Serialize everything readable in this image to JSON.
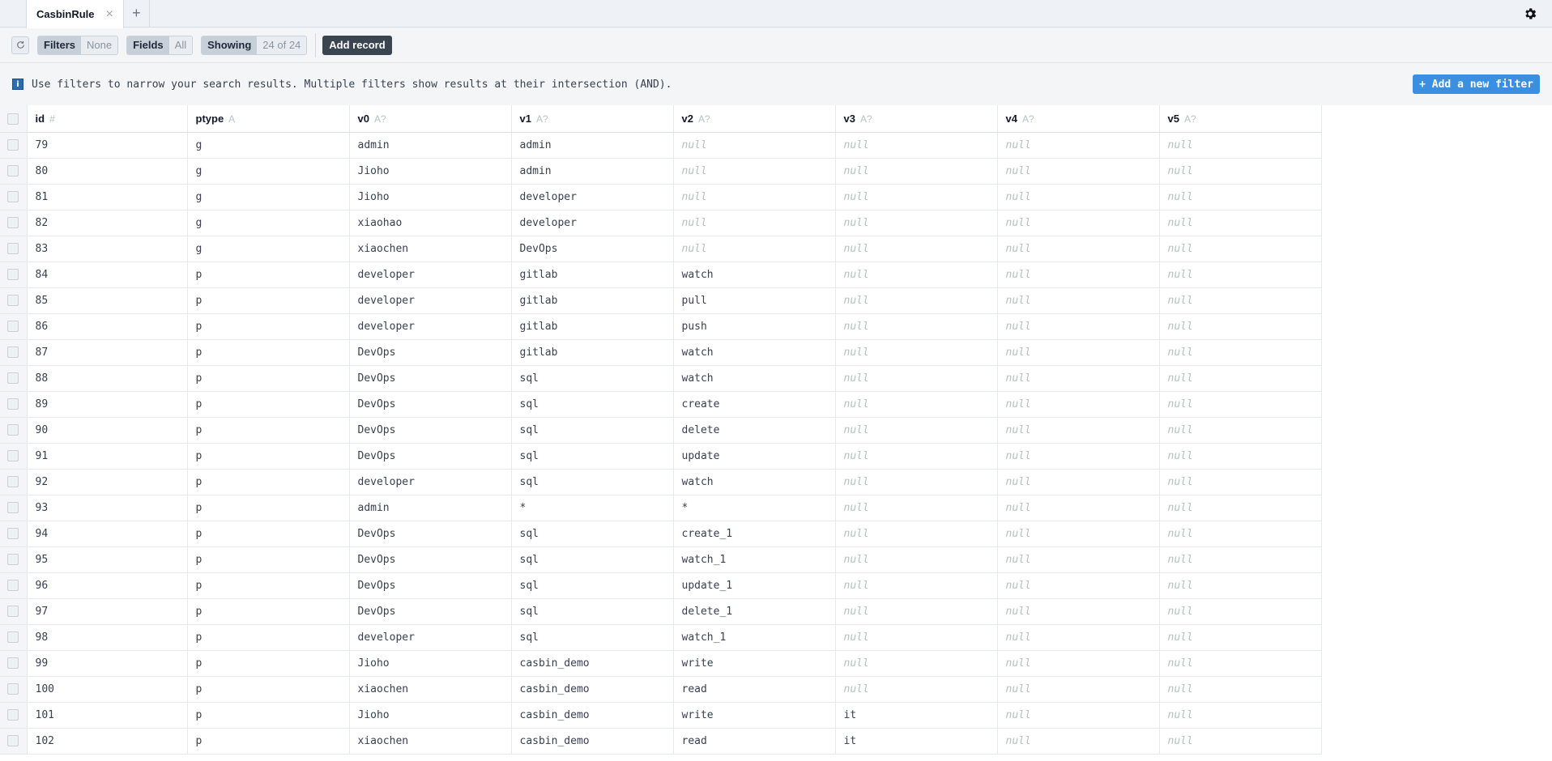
{
  "tab": {
    "label": "CasbinRule",
    "close_glyph": "×",
    "new_glyph": "+"
  },
  "toolbar": {
    "filters_label": "Filters",
    "filters_value": "None",
    "fields_label": "Fields",
    "fields_value": "All",
    "showing_label": "Showing",
    "showing_value": "24 of 24",
    "add_record": "Add record"
  },
  "info": {
    "icon": "i",
    "text": "Use filters to narrow your search results. Multiple filters show results at their intersection (AND).",
    "add_filter": "+ Add a new filter"
  },
  "columns": [
    {
      "name": "id",
      "hint": "#"
    },
    {
      "name": "ptype",
      "hint": "A"
    },
    {
      "name": "v0",
      "hint": "A?"
    },
    {
      "name": "v1",
      "hint": "A?"
    },
    {
      "name": "v2",
      "hint": "A?"
    },
    {
      "name": "v3",
      "hint": "A?"
    },
    {
      "name": "v4",
      "hint": "A?"
    },
    {
      "name": "v5",
      "hint": "A?"
    }
  ],
  "rows": [
    [
      "79",
      "g",
      "admin",
      "admin",
      null,
      null,
      null,
      null
    ],
    [
      "80",
      "g",
      "Jioho",
      "admin",
      null,
      null,
      null,
      null
    ],
    [
      "81",
      "g",
      "Jioho",
      "developer",
      null,
      null,
      null,
      null
    ],
    [
      "82",
      "g",
      "xiaohao",
      "developer",
      null,
      null,
      null,
      null
    ],
    [
      "83",
      "g",
      "xiaochen",
      "DevOps",
      null,
      null,
      null,
      null
    ],
    [
      "84",
      "p",
      "developer",
      "gitlab",
      "watch",
      null,
      null,
      null
    ],
    [
      "85",
      "p",
      "developer",
      "gitlab",
      "pull",
      null,
      null,
      null
    ],
    [
      "86",
      "p",
      "developer",
      "gitlab",
      "push",
      null,
      null,
      null
    ],
    [
      "87",
      "p",
      "DevOps",
      "gitlab",
      "watch",
      null,
      null,
      null
    ],
    [
      "88",
      "p",
      "DevOps",
      "sql",
      "watch",
      null,
      null,
      null
    ],
    [
      "89",
      "p",
      "DevOps",
      "sql",
      "create",
      null,
      null,
      null
    ],
    [
      "90",
      "p",
      "DevOps",
      "sql",
      "delete",
      null,
      null,
      null
    ],
    [
      "91",
      "p",
      "DevOps",
      "sql",
      "update",
      null,
      null,
      null
    ],
    [
      "92",
      "p",
      "developer",
      "sql",
      "watch",
      null,
      null,
      null
    ],
    [
      "93",
      "p",
      "admin",
      "*",
      "*",
      null,
      null,
      null
    ],
    [
      "94",
      "p",
      "DevOps",
      "sql",
      "create_1",
      null,
      null,
      null
    ],
    [
      "95",
      "p",
      "DevOps",
      "sql",
      "watch_1",
      null,
      null,
      null
    ],
    [
      "96",
      "p",
      "DevOps",
      "sql",
      "update_1",
      null,
      null,
      null
    ],
    [
      "97",
      "p",
      "DevOps",
      "sql",
      "delete_1",
      null,
      null,
      null
    ],
    [
      "98",
      "p",
      "developer",
      "sql",
      "watch_1",
      null,
      null,
      null
    ],
    [
      "99",
      "p",
      "Jioho",
      "casbin_demo",
      "write",
      null,
      null,
      null
    ],
    [
      "100",
      "p",
      "xiaochen",
      "casbin_demo",
      "read",
      null,
      null,
      null
    ],
    [
      "101",
      "p",
      "Jioho",
      "casbin_demo",
      "write",
      "it",
      null,
      null
    ],
    [
      "102",
      "p",
      "xiaochen",
      "casbin_demo",
      "read",
      "it",
      null,
      null
    ]
  ],
  "null_text": "null",
  "colors": {
    "accent": "#3b8fe0",
    "dark_button": "#3b4552",
    "null_text": "#b6bfc9"
  }
}
